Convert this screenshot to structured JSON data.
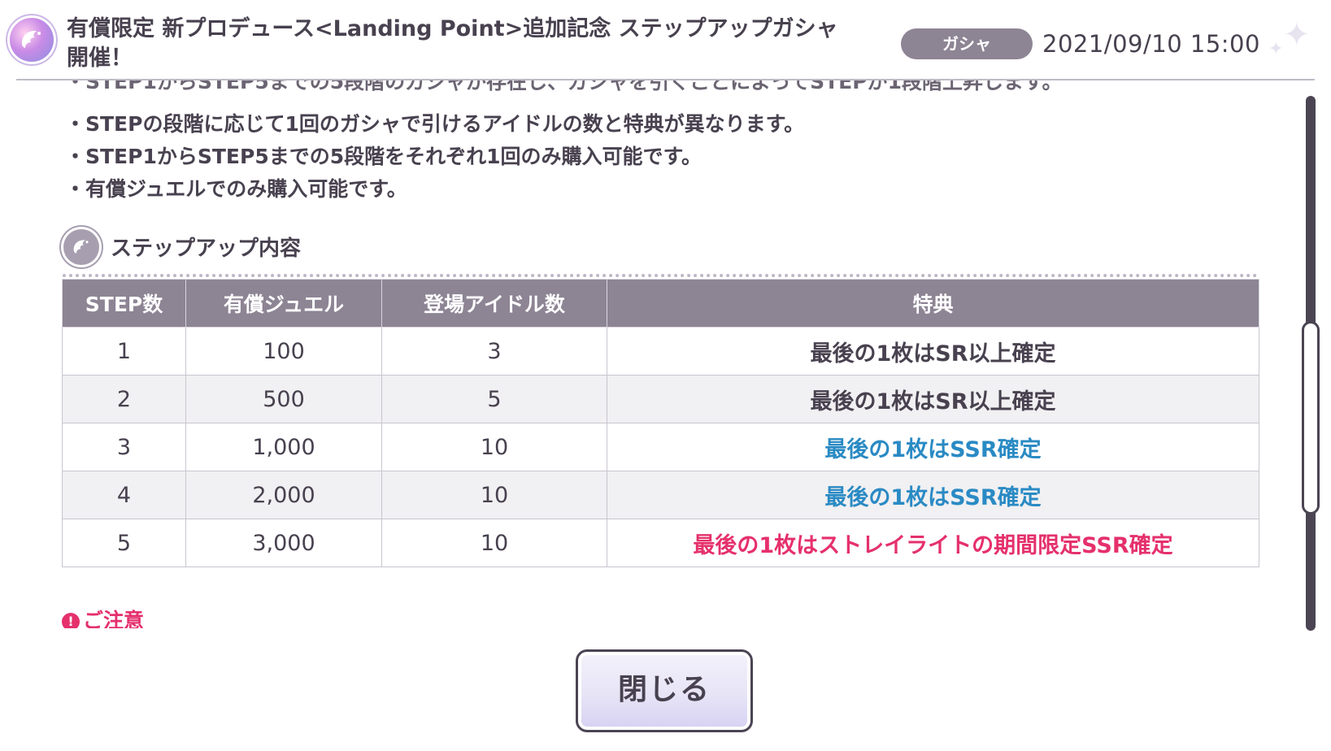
{
  "header": {
    "title_line1": "有償限定 新プロデュース<Landing Point>追加記念 ステップアップガシャ",
    "title_line2": "開催！",
    "category": "ガシャ",
    "date": "2021/09/10 15:00"
  },
  "content": {
    "bullets": [
      "・STEPの段階に応じて1回のガシャで引けるアイドルの数と特典が異なります。",
      "・STEP1からSTEP5までの5段階をそれぞれ1回のみ購入可能です。",
      "・有償ジュエルでのみ購入可能です。"
    ],
    "section_title": "ステップアップ内容",
    "table": {
      "headers": [
        "STEP数",
        "有償ジュエル",
        "登場アイドル数",
        "特典"
      ],
      "rows": [
        {
          "step": "1",
          "jewel": "100",
          "idols": "3",
          "perk": "最後の1枚はSR以上確定",
          "perk_color": "#48414f"
        },
        {
          "step": "2",
          "jewel": "500",
          "idols": "5",
          "perk": "最後の1枚はSR以上確定",
          "perk_color": "#48414f"
        },
        {
          "step": "3",
          "jewel": "1,000",
          "idols": "10",
          "perk": "最後の1枚はSSR確定",
          "perk_color": "#2a8ac4"
        },
        {
          "step": "4",
          "jewel": "2,000",
          "idols": "10",
          "perk": "最後の1枚はSSR確定",
          "perk_color": "#2a8ac4"
        },
        {
          "step": "5",
          "jewel": "3,000",
          "idols": "10",
          "perk": "最後の1枚はストレイライトの期間限定SSR確定",
          "perk_color": "#e5306c"
        }
      ]
    },
    "notice_label": "ご注意"
  },
  "footer": {
    "close_label": "閉じる"
  }
}
